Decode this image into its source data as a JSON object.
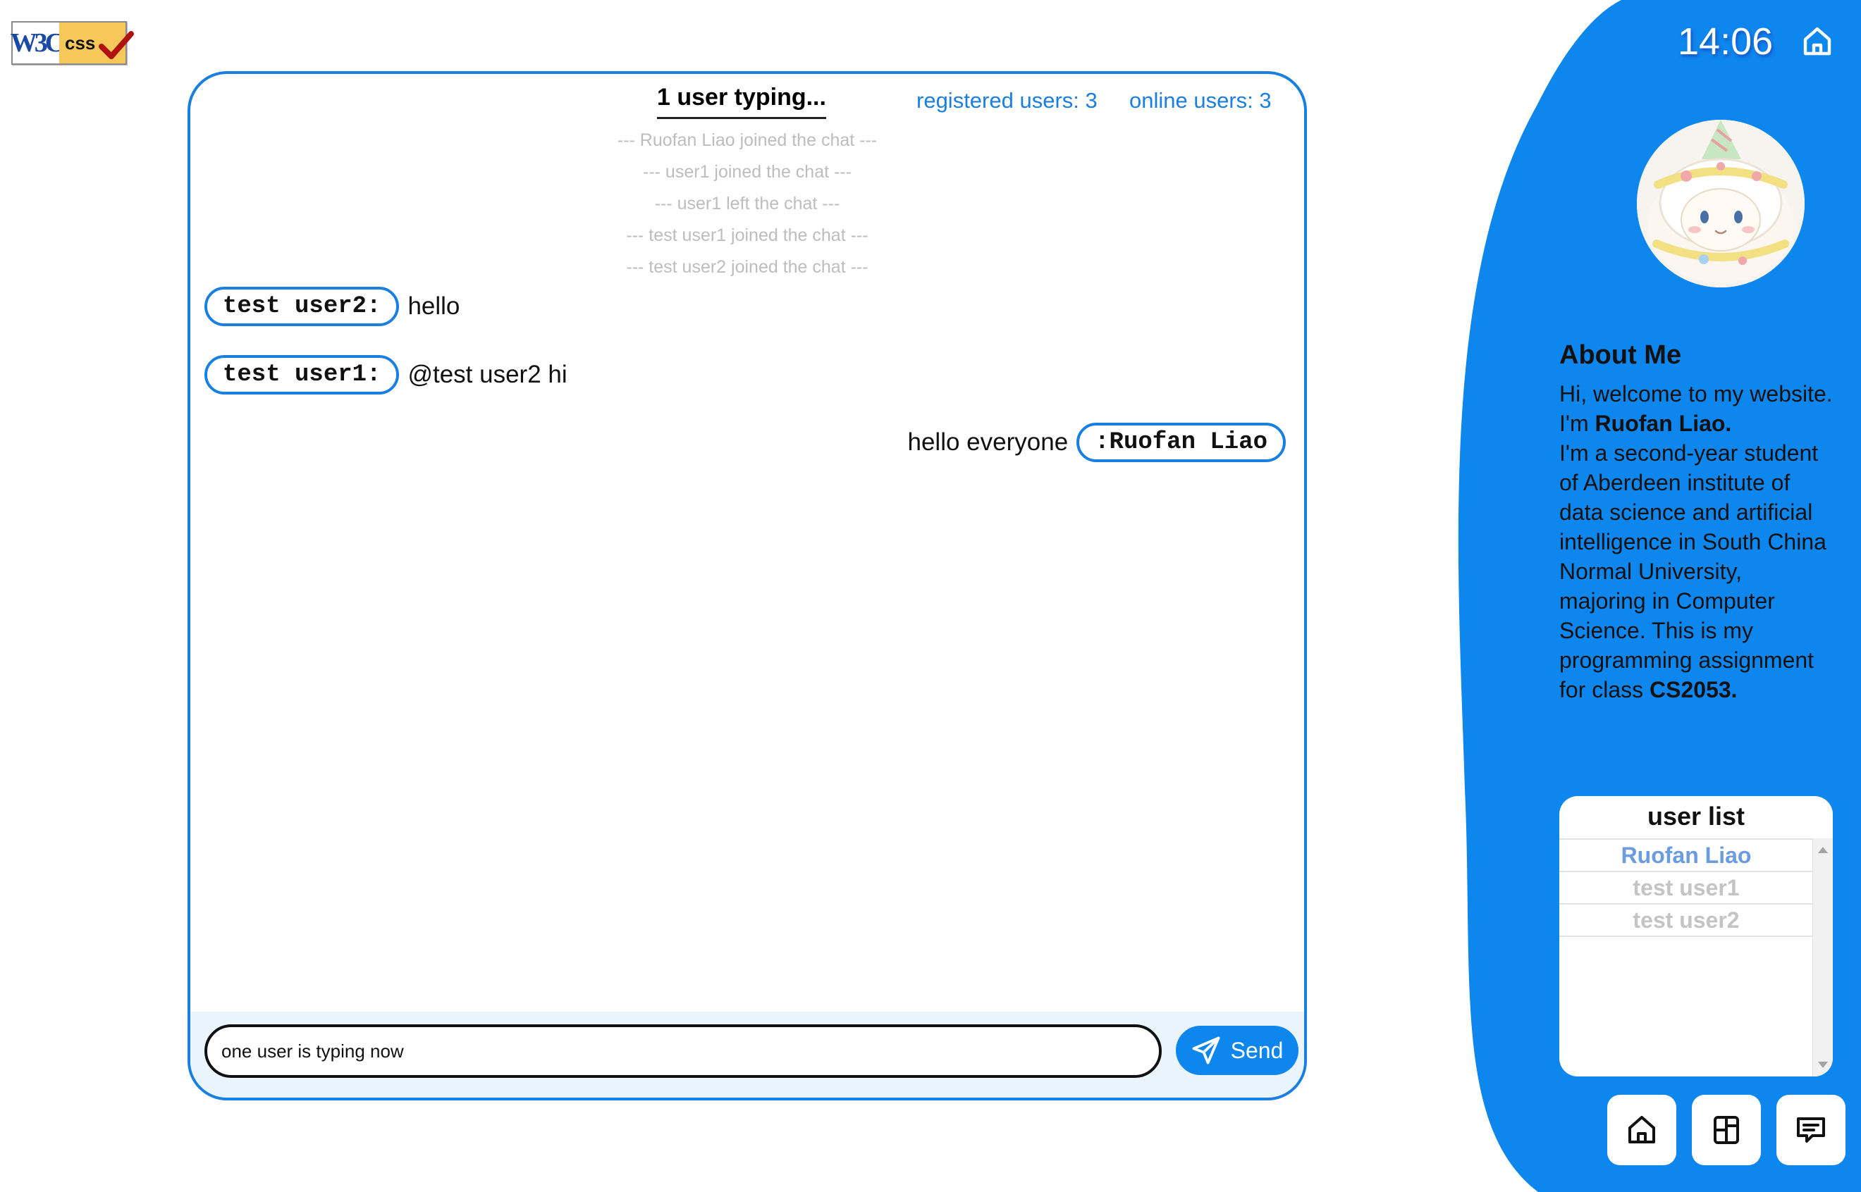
{
  "badge": {
    "w3c_text": "W3C",
    "css_text": "css"
  },
  "chat": {
    "typing_status": "1 user typing...",
    "registered_users": "registered users: 3",
    "online_users": "online users: 3",
    "system_messages": [
      "--- Ruofan Liao joined the chat ---",
      "--- user1 joined the chat ---",
      "--- user1 left the chat ---",
      "--- test user1 joined the chat ---",
      "--- test user2 joined the chat ---"
    ],
    "messages": [
      {
        "sender": "test user2:",
        "text": "hello"
      },
      {
        "sender": "test user1:",
        "text": "@test user2 hi"
      },
      {
        "sender": ":Ruofan Liao",
        "text": "hello everyone"
      }
    ],
    "input_value": "one user is typing now",
    "send_label": "Send"
  },
  "sidebar": {
    "time": "14:06",
    "about_title": "About Me",
    "about_intro": "Hi, welcome to my website. I'm ",
    "about_name": "Ruofan Liao.",
    "about_body": "I'm a second-year student of Aberdeen institute of data science and artificial intelligence in South China Normal University, majoring in Computer Science. This is my programming assignment for class ",
    "about_class": "CS2053.",
    "user_list_title": "user list",
    "users": [
      {
        "name": "Ruofan Liao",
        "status": "online"
      },
      {
        "name": "test user1",
        "status": "offline"
      },
      {
        "name": "test user2",
        "status": "offline"
      }
    ]
  },
  "icons": {
    "top_right": "home-icon",
    "nav": [
      "home-icon",
      "layout-icon",
      "chat-icon"
    ],
    "send": "paper-plane-icon"
  },
  "colors": {
    "accent": "#1a7fe0",
    "sidebar": "#0d86ee",
    "input_bar": "#eaf4fd",
    "system_text": "#bdbdbd",
    "online_user": "#6b9be0",
    "offline_user": "#c4c4c4"
  }
}
